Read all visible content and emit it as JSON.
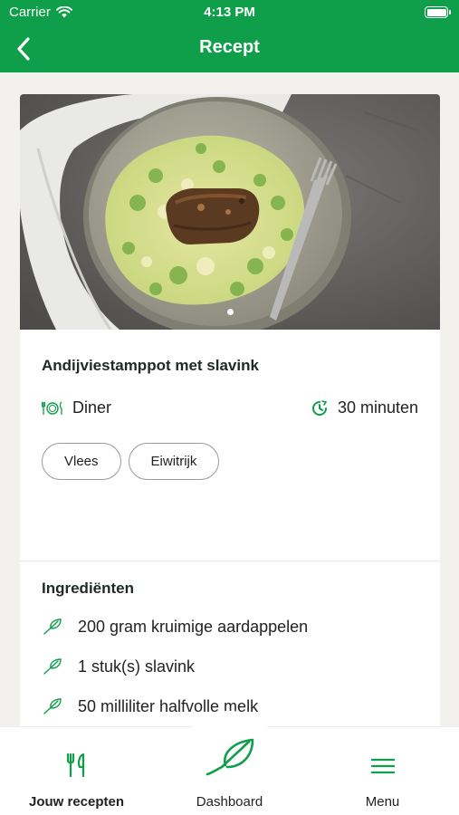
{
  "status_bar": {
    "carrier": "Carrier",
    "time": "4:13 PM"
  },
  "nav": {
    "title": "Recept",
    "back_icon": "chevron-left-icon"
  },
  "recipe": {
    "title": "Andijviestamppot met slavink",
    "meal_type": "Diner",
    "duration": "30 minuten",
    "tags": [
      "Vlees",
      "Eiwitrijk"
    ],
    "photo_page_count": 1
  },
  "ingredients": {
    "title": "Ingrediënten",
    "items": [
      "200 gram kruimige aardappelen",
      "1 stuk(s) slavink",
      "50 milliliter halfvolle melk"
    ]
  },
  "tabbar": {
    "tabs": [
      {
        "label": "Jouw recepten",
        "icon": "cutlery-icon",
        "active": true
      },
      {
        "label": "Dashboard",
        "icon": "leaf-icon",
        "active": false
      },
      {
        "label": "Menu",
        "icon": "hamburger-icon",
        "active": false
      }
    ]
  },
  "colors": {
    "brand_green": "#0f9e4a",
    "text_dark": "#1e2a26"
  }
}
